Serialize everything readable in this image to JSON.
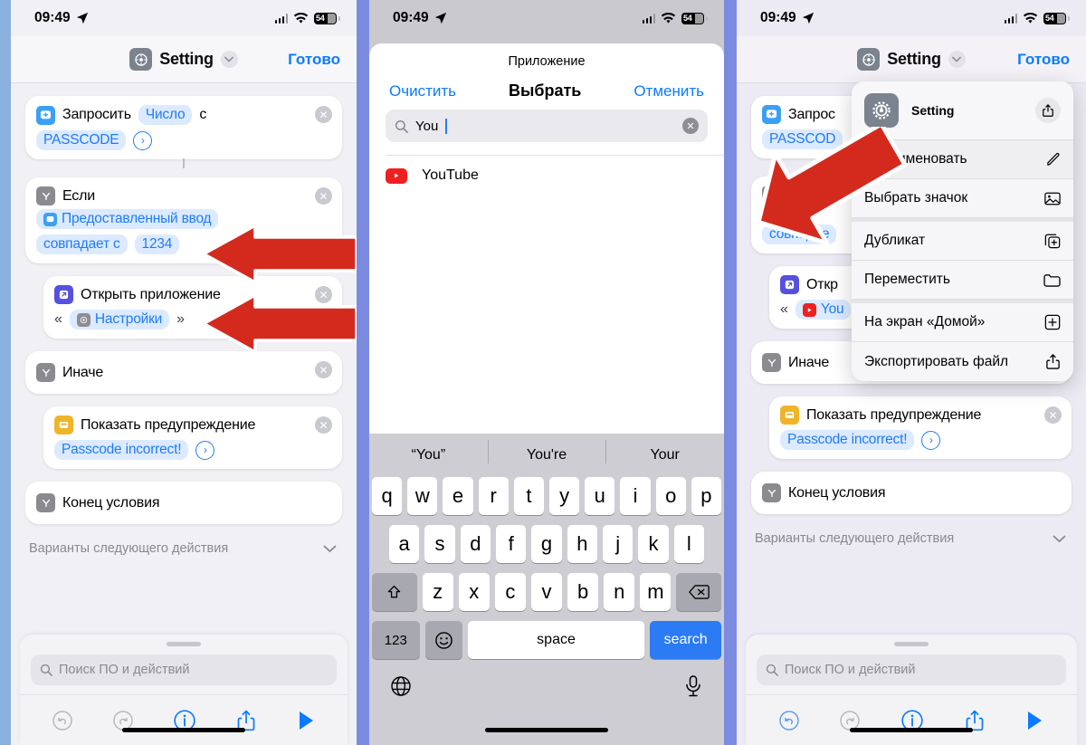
{
  "status_bar": {
    "time": "09:49",
    "location_icon": "location-arrow-icon",
    "wifi_icon": "wifi-icon",
    "battery_text": "54"
  },
  "panel1": {
    "nav": {
      "app_icon": "shortcuts-gear-icon",
      "title": "Setting",
      "chevron": "chevron-down-icon",
      "done_label": "Готово"
    },
    "actions": [
      {
        "icon": "ask-input-icon",
        "label": "Запросить",
        "token1": "Число",
        "mid": "с",
        "token2": "PASSCODE",
        "disclosure": "chevron-right-circle-icon",
        "close": "close-icon"
      },
      {
        "icon": "if-icon",
        "label": "Если",
        "token1": "Предоставленный ввод",
        "mid": "совпадает с",
        "token2": "1234",
        "close": "close-icon"
      },
      {
        "icon": "open-app-icon",
        "label": "Открыть приложение",
        "quote_open": "«",
        "token1": "Настройки",
        "quote_close": "»",
        "close": "close-icon"
      },
      {
        "icon": "if-icon",
        "label": "Иначе",
        "close": "close-icon"
      },
      {
        "icon": "alert-icon",
        "label": "Показать предупреждение",
        "token1": "Passcode incorrect!",
        "disclosure": "chevron-right-circle-icon",
        "close": "close-icon"
      },
      {
        "icon": "if-icon",
        "label": "Конец условия"
      }
    ],
    "next_options": {
      "label": "Варианты следующего действия",
      "chevron": "chevron-down-icon"
    },
    "sheet": {
      "search_placeholder": "Поиск ПО и действий",
      "search_icon": "search-icon"
    },
    "toolbar": [
      {
        "name": "undo-button",
        "icon": "undo-icon"
      },
      {
        "name": "redo-button",
        "icon": "redo-icon"
      },
      {
        "name": "info-button",
        "icon": "info-circle-icon"
      },
      {
        "name": "share-button",
        "icon": "share-icon"
      },
      {
        "name": "run-button",
        "icon": "play-icon"
      }
    ]
  },
  "panel2": {
    "picker_title": "Приложение",
    "clear_label": "Очистить",
    "select_label": "Выбрать",
    "cancel_label": "Отменить",
    "search": {
      "value": "You",
      "icon": "search-icon",
      "clear_icon": "clear-circle-icon"
    },
    "results": [
      {
        "icon": "youtube-icon",
        "name": "YouTube"
      }
    ],
    "keyboard": {
      "suggestions": [
        "“You”",
        "You're",
        "Your"
      ],
      "row1": [
        "q",
        "w",
        "e",
        "r",
        "t",
        "y",
        "u",
        "i",
        "o",
        "p"
      ],
      "row2": [
        "a",
        "s",
        "d",
        "f",
        "g",
        "h",
        "j",
        "k",
        "l"
      ],
      "row3": [
        "z",
        "x",
        "c",
        "v",
        "b",
        "n",
        "m"
      ],
      "shift_icon": "shift-icon",
      "backspace_icon": "backspace-icon",
      "num_label": "123",
      "emoji_icon": "emoji-icon",
      "space_label": "space",
      "search_label": "search",
      "globe_icon": "globe-icon",
      "mic_icon": "microphone-icon"
    }
  },
  "panel3": {
    "nav": {
      "app_icon": "shortcuts-gear-icon",
      "title": "Setting",
      "chevron": "chevron-down-icon",
      "done_label": "Готово"
    },
    "context_menu": {
      "header": {
        "icon": "gear-icon",
        "name": "Setting",
        "share_icon": "share-icon"
      },
      "items": [
        {
          "label": "Переименовать",
          "icon": "pencil-icon"
        },
        {
          "label": "Выбрать значок",
          "icon": "photo-icon"
        },
        {
          "label": "Дубликат",
          "icon": "duplicate-icon"
        },
        {
          "label": "Переместить",
          "icon": "folder-icon"
        },
        {
          "label": "На экран «Домой»",
          "icon": "plus-square-icon"
        },
        {
          "label": "Экспортировать файл",
          "icon": "export-icon"
        }
      ]
    },
    "actions": [
      {
        "icon": "ask-input-icon",
        "label": "Запрос",
        "token2": "PASSCOD"
      },
      {
        "icon": "if-icon",
        "mid": "совпадае"
      },
      {
        "icon": "open-app-icon",
        "label": "Откр",
        "quote_open": "«",
        "token1": "You"
      },
      {
        "icon": "if-icon",
        "label": "Иначе",
        "close": "close-icon"
      },
      {
        "icon": "alert-icon",
        "label": "Показать предупреждение",
        "token1": "Passcode incorrect!",
        "disclosure": "chevron-right-circle-icon",
        "close": "close-icon"
      },
      {
        "icon": "if-icon",
        "label": "Конец условия"
      }
    ],
    "next_options": {
      "label": "Варианты следующего действия",
      "chevron": "chevron-down-icon"
    },
    "sheet": {
      "search_placeholder": "Поиск ПО и действий",
      "search_icon": "search-icon"
    }
  },
  "annotations": [
    {
      "name": "red-arrow-condition",
      "points": "left"
    },
    {
      "name": "red-arrow-open-app",
      "points": "left"
    },
    {
      "name": "red-arrow-rename",
      "points": "upper-right"
    }
  ],
  "colors": {
    "accent_blue": "#0a7bff",
    "token_blue": "#1f7bfa",
    "token_bg": "#dceaff",
    "divider_purple": "#7b8ce0",
    "edge_purple": "#7a5cf0",
    "red_arrow": "#d42a1e"
  }
}
